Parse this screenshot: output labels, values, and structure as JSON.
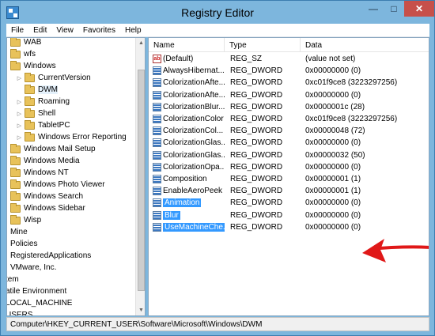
{
  "window": {
    "title": "Registry Editor",
    "min_glyph": "—",
    "max_glyph": "□",
    "close_glyph": "✕"
  },
  "menu": [
    "File",
    "Edit",
    "View",
    "Favorites",
    "Help"
  ],
  "tree": {
    "items": [
      {
        "label": "WAB",
        "expander": "",
        "folder": true
      },
      {
        "label": "wfs",
        "expander": "",
        "folder": true
      },
      {
        "label": "Windows",
        "expander": "",
        "folder": true
      },
      {
        "label": "CurrentVersion",
        "expander": "▷",
        "folder": true
      },
      {
        "label": "DWM",
        "expander": "",
        "folder": true,
        "selected": true
      },
      {
        "label": "Roaming",
        "expander": "▷",
        "folder": true
      },
      {
        "label": "Shell",
        "expander": "▷",
        "folder": true
      },
      {
        "label": "TabletPC",
        "expander": "▷",
        "folder": true
      },
      {
        "label": "Windows Error Reporting",
        "expander": "▷",
        "folder": true
      },
      {
        "label": "Windows Mail Setup",
        "expander": "",
        "folder": true
      },
      {
        "label": "Windows Media",
        "expander": "",
        "folder": true
      },
      {
        "label": "Windows NT",
        "expander": "",
        "folder": true
      },
      {
        "label": "Windows Photo Viewer",
        "expander": "",
        "folder": true
      },
      {
        "label": "Windows Search",
        "expander": "",
        "folder": true
      },
      {
        "label": "Windows Sidebar",
        "expander": "",
        "folder": true
      },
      {
        "label": "Wisp",
        "expander": "",
        "folder": true
      },
      {
        "label": "Mine",
        "expander": "",
        "folder": false
      },
      {
        "label": "Policies",
        "expander": "",
        "folder": false
      },
      {
        "label": "RegisteredApplications",
        "expander": "",
        "folder": false
      },
      {
        "label": "VMware, Inc.",
        "expander": "",
        "folder": false
      },
      {
        "label": "tem",
        "expander": "",
        "folder": false
      },
      {
        "label": "atile Environment",
        "expander": "",
        "folder": false
      },
      {
        "label": "LOCAL_MACHINE",
        "expander": "",
        "folder": false
      },
      {
        "label": "USERS",
        "expander": "",
        "folder": false
      }
    ]
  },
  "list": {
    "headers": [
      "Name",
      "Type",
      "Data"
    ],
    "rows": [
      {
        "name": "(Default)",
        "type": "REG_SZ",
        "data": "(value not set)",
        "icon": "ab"
      },
      {
        "name": "AlwaysHibernat...",
        "type": "REG_DWORD",
        "data": "0x00000000 (0)",
        "icon": "dword"
      },
      {
        "name": "ColorizationAfte...",
        "type": "REG_DWORD",
        "data": "0xc01f9ce8 (3223297256)",
        "icon": "dword"
      },
      {
        "name": "ColorizationAfte...",
        "type": "REG_DWORD",
        "data": "0x00000000 (0)",
        "icon": "dword"
      },
      {
        "name": "ColorizationBlur...",
        "type": "REG_DWORD",
        "data": "0x0000001c (28)",
        "icon": "dword"
      },
      {
        "name": "ColorizationColor",
        "type": "REG_DWORD",
        "data": "0xc01f9ce8 (3223297256)",
        "icon": "dword"
      },
      {
        "name": "ColorizationCol...",
        "type": "REG_DWORD",
        "data": "0x00000048 (72)",
        "icon": "dword"
      },
      {
        "name": "ColorizationGlas...",
        "type": "REG_DWORD",
        "data": "0x00000000 (0)",
        "icon": "dword"
      },
      {
        "name": "ColorizationGlas...",
        "type": "REG_DWORD",
        "data": "0x00000032 (50)",
        "icon": "dword"
      },
      {
        "name": "ColorizationOpa...",
        "type": "REG_DWORD",
        "data": "0x00000000 (0)",
        "icon": "dword"
      },
      {
        "name": "Composition",
        "type": "REG_DWORD",
        "data": "0x00000001 (1)",
        "icon": "dword"
      },
      {
        "name": "EnableAeroPeek",
        "type": "REG_DWORD",
        "data": "0x00000001 (1)",
        "icon": "dword"
      },
      {
        "name": "Animation",
        "type": "REG_DWORD",
        "data": "0x00000000 (0)",
        "icon": "dword",
        "selected": true
      },
      {
        "name": "Blur",
        "type": "REG_DWORD",
        "data": "0x00000000 (0)",
        "icon": "dword",
        "selected": true
      },
      {
        "name": "UseMachineChe...",
        "type": "REG_DWORD",
        "data": "0x00000000 (0)",
        "icon": "dword",
        "selected": true
      }
    ]
  },
  "status": {
    "path": "Computer\\HKEY_CURRENT_USER\\Software\\Microsoft\\Windows\\DWM"
  },
  "colors": {
    "selection": "#3399ff",
    "annotation_arrow": "#e01818",
    "title_bar": "#7db6dd"
  },
  "annotation": {
    "shape": "red-arrow",
    "points_to": "Blur"
  }
}
